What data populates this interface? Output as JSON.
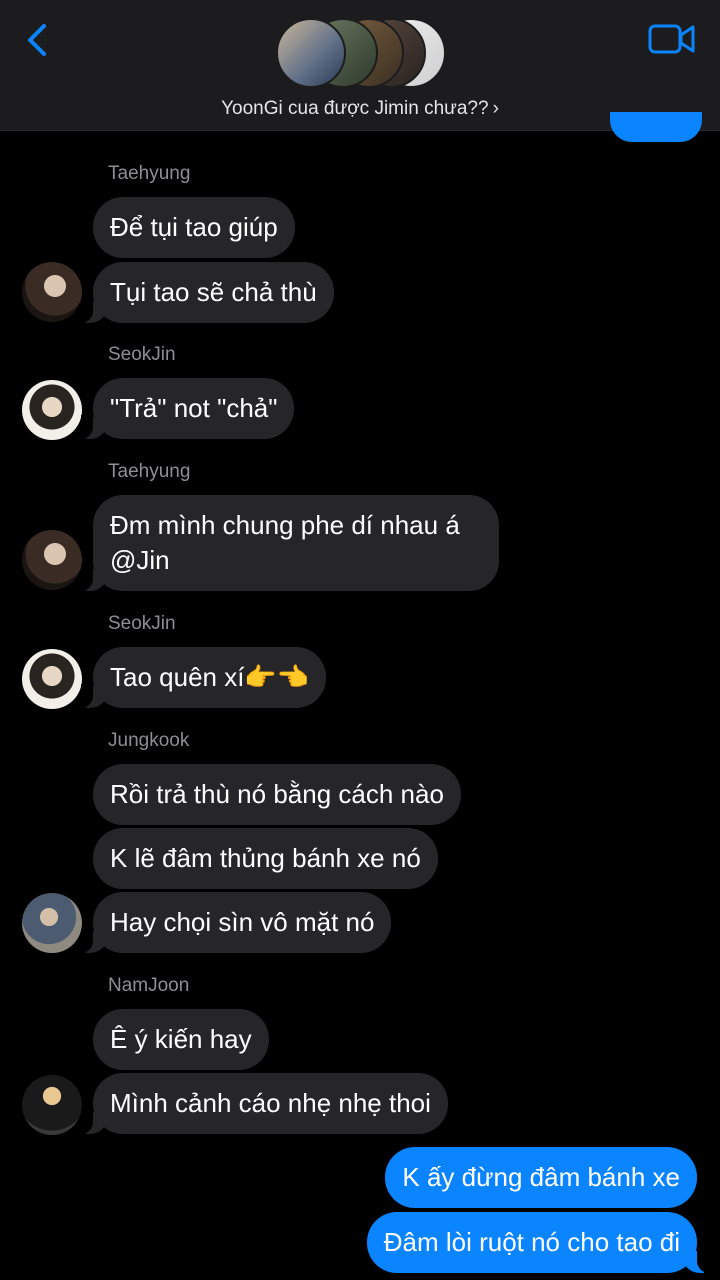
{
  "header": {
    "group_name": "YoonGi cua được Jimin chưa??",
    "chevron": "›"
  },
  "colors": {
    "accent": "#0a84ff",
    "bubble_gray": "#262628",
    "name_gray": "#8e8e93"
  },
  "messages": [
    {
      "sender": "Taehyung",
      "bubbles": [
        "Để tụi tao giúp",
        "Tụi tao sẽ chả thù"
      ]
    },
    {
      "sender": "SeokJin",
      "bubbles": [
        "\"Trả\" not \"chả\""
      ]
    },
    {
      "sender": "Taehyung",
      "bubbles": [
        "Đm mình chung phe dí nhau á @Jin"
      ]
    },
    {
      "sender": "SeokJin",
      "bubbles": [
        "Tao quên xí👉👈"
      ]
    },
    {
      "sender": "Jungkook",
      "bubbles": [
        "Rồi trả thù nó bằng cách nào",
        "K lẽ đâm thủng bánh xe nó",
        "Hay chọi sìn vô mặt nó"
      ]
    },
    {
      "sender": "NamJoon",
      "bubbles": [
        "Ê ý kiến hay",
        "Mình cảnh cáo nhẹ nhẹ thoi"
      ]
    }
  ],
  "outgoing": [
    "K ấy đừng đâm bánh xe",
    "Đâm lòi ruột nó cho tao đi"
  ],
  "icons": {
    "back": "chevron-left-icon",
    "video": "video-camera-icon"
  }
}
